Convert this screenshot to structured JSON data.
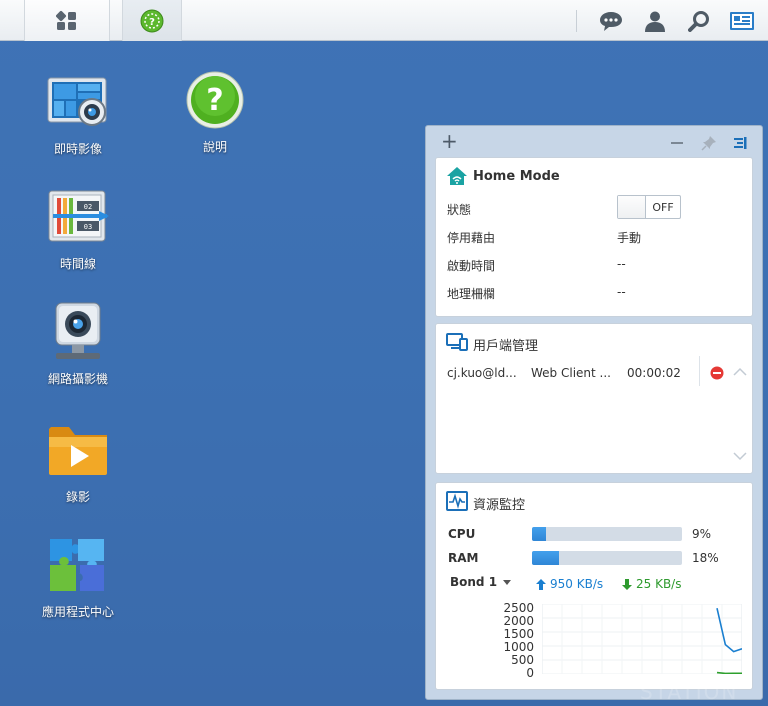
{
  "topbar": {
    "main_menu_icon": "grid-icon",
    "active_app_icon": "help-app-icon",
    "right_icons": [
      "chat-icon",
      "user-icon",
      "search-icon",
      "widgets-icon"
    ]
  },
  "desktop": {
    "items": [
      {
        "label": "即時影像",
        "icon": "live-view-icon"
      },
      {
        "label": "說明",
        "icon": "help-icon"
      },
      {
        "label": "時間線",
        "icon": "timeline-icon"
      },
      {
        "label": "網路攝影機",
        "icon": "ip-camera-icon"
      },
      {
        "label": "錄影",
        "icon": "recording-folder-icon"
      },
      {
        "label": "應用程式中心",
        "icon": "app-center-icon"
      }
    ]
  },
  "panel": {
    "add_label": "+",
    "home_mode": {
      "title": "Home Mode",
      "rows": [
        {
          "label": "狀態",
          "value": "OFF"
        },
        {
          "label": "停用藉由",
          "value": "手動"
        },
        {
          "label": "啟動時間",
          "value": "--"
        },
        {
          "label": "地理柵欄",
          "value": "--"
        }
      ]
    },
    "client_mgmt": {
      "title": "用戶端管理",
      "client": {
        "user": "cj.kuo@ld...",
        "type": "Web Client ...",
        "duration": "00:00:02"
      }
    },
    "resource_monitor": {
      "title": "資源監控",
      "cpu": {
        "label": "CPU",
        "percent_text": "9%",
        "percent": 9
      },
      "ram": {
        "label": "RAM",
        "percent_text": "18%",
        "percent": 18
      },
      "network": {
        "interface": "Bond 1",
        "upload": "950 KB/s",
        "download": "25 KB/s"
      },
      "chart_y_ticks": [
        "2500",
        "2000",
        "1500",
        "1000",
        "500",
        "0"
      ],
      "colors": {
        "upload": "#1a7fd0",
        "download": "#2ea02e",
        "bar": "#3596e3"
      }
    }
  },
  "chart_data": {
    "type": "line",
    "ylim": [
      0,
      2500
    ],
    "yticks": [
      2500,
      2000,
      1500,
      1000,
      500,
      0
    ],
    "series": [
      {
        "values": [
          2350,
          1050,
          800,
          900
        ]
      },
      {
        "values": [
          50,
          20,
          25,
          25
        ]
      }
    ]
  }
}
